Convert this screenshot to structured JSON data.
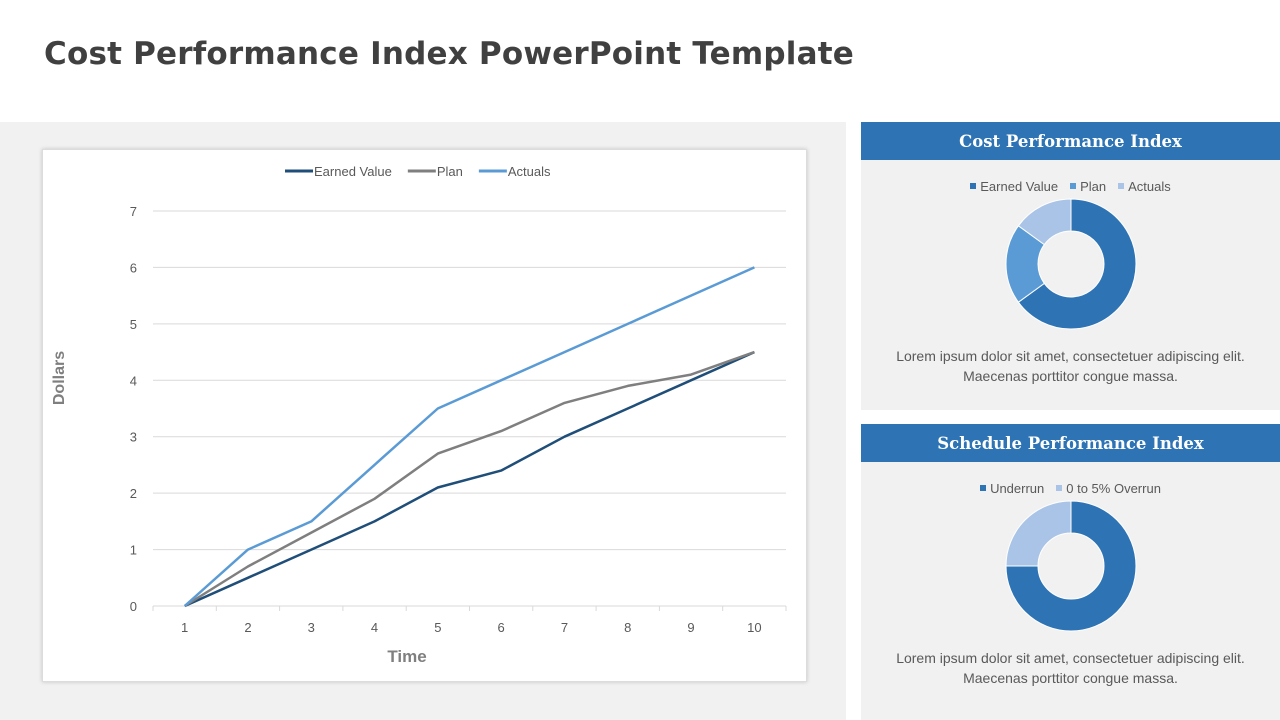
{
  "page": {
    "title": "Cost Performance Index PowerPoint Template"
  },
  "colors": {
    "earned_value": "#1f4e79",
    "plan": "#7f7f7f",
    "actuals": "#5b9bd5",
    "panel_header": "#2e74b5",
    "donut_dark": "#2e74b5",
    "donut_mid": "#5b9bd5",
    "donut_light": "#a9c4e6"
  },
  "chart_data": [
    {
      "type": "line",
      "title": "",
      "xlabel": "Time",
      "ylabel": "Dollars",
      "x": [
        1,
        2,
        3,
        4,
        5,
        6,
        7,
        8,
        9,
        10
      ],
      "xticks": [
        "1",
        "2",
        "3",
        "4",
        "5",
        "6",
        "7",
        "8",
        "9",
        "10"
      ],
      "yticks": [
        "0",
        "1",
        "2",
        "3",
        "4",
        "5",
        "6",
        "7"
      ],
      "ylim": [
        0,
        7
      ],
      "grid": true,
      "legend_position": "top",
      "series": [
        {
          "name": "Earned Value",
          "color": "#1f4e79",
          "values": [
            0,
            0.5,
            1.0,
            1.5,
            2.1,
            2.4,
            3.0,
            3.5,
            4.0,
            4.5
          ]
        },
        {
          "name": "Plan",
          "color": "#7f7f7f",
          "values": [
            0,
            0.7,
            1.3,
            1.9,
            2.7,
            3.1,
            3.6,
            3.9,
            4.1,
            4.5
          ]
        },
        {
          "name": "Actuals",
          "color": "#5b9bd5",
          "values": [
            0,
            1.0,
            1.5,
            2.5,
            3.5,
            4.0,
            4.5,
            5.0,
            5.5,
            6.0
          ]
        }
      ]
    },
    {
      "type": "pie",
      "variant": "donut",
      "title": "Cost Performance Index",
      "legend_position": "top",
      "categories": [
        "Earned Value",
        "Plan",
        "Actuals"
      ],
      "values": [
        65,
        20,
        15
      ],
      "colors": [
        "#2e74b5",
        "#5b9bd5",
        "#a9c4e6"
      ]
    },
    {
      "type": "pie",
      "variant": "donut",
      "title": "Schedule Performance Index",
      "legend_position": "top",
      "categories": [
        "Underrun",
        "0 to 5% Overrun"
      ],
      "values": [
        75,
        25
      ],
      "colors": [
        "#2e74b5",
        "#a9c4e6"
      ]
    }
  ],
  "panels": [
    {
      "header": "Cost Performance Index",
      "text_line1": "Lorem ipsum dolor sit amet, consectetuer adipiscing elit.",
      "text_line2": "Maecenas porttitor  congue massa."
    },
    {
      "header": "Schedule  Performance Index",
      "text_line1": "Lorem ipsum dolor sit amet, consectetuer adipiscing elit.",
      "text_line2": "Maecenas porttitor  congue massa."
    }
  ]
}
